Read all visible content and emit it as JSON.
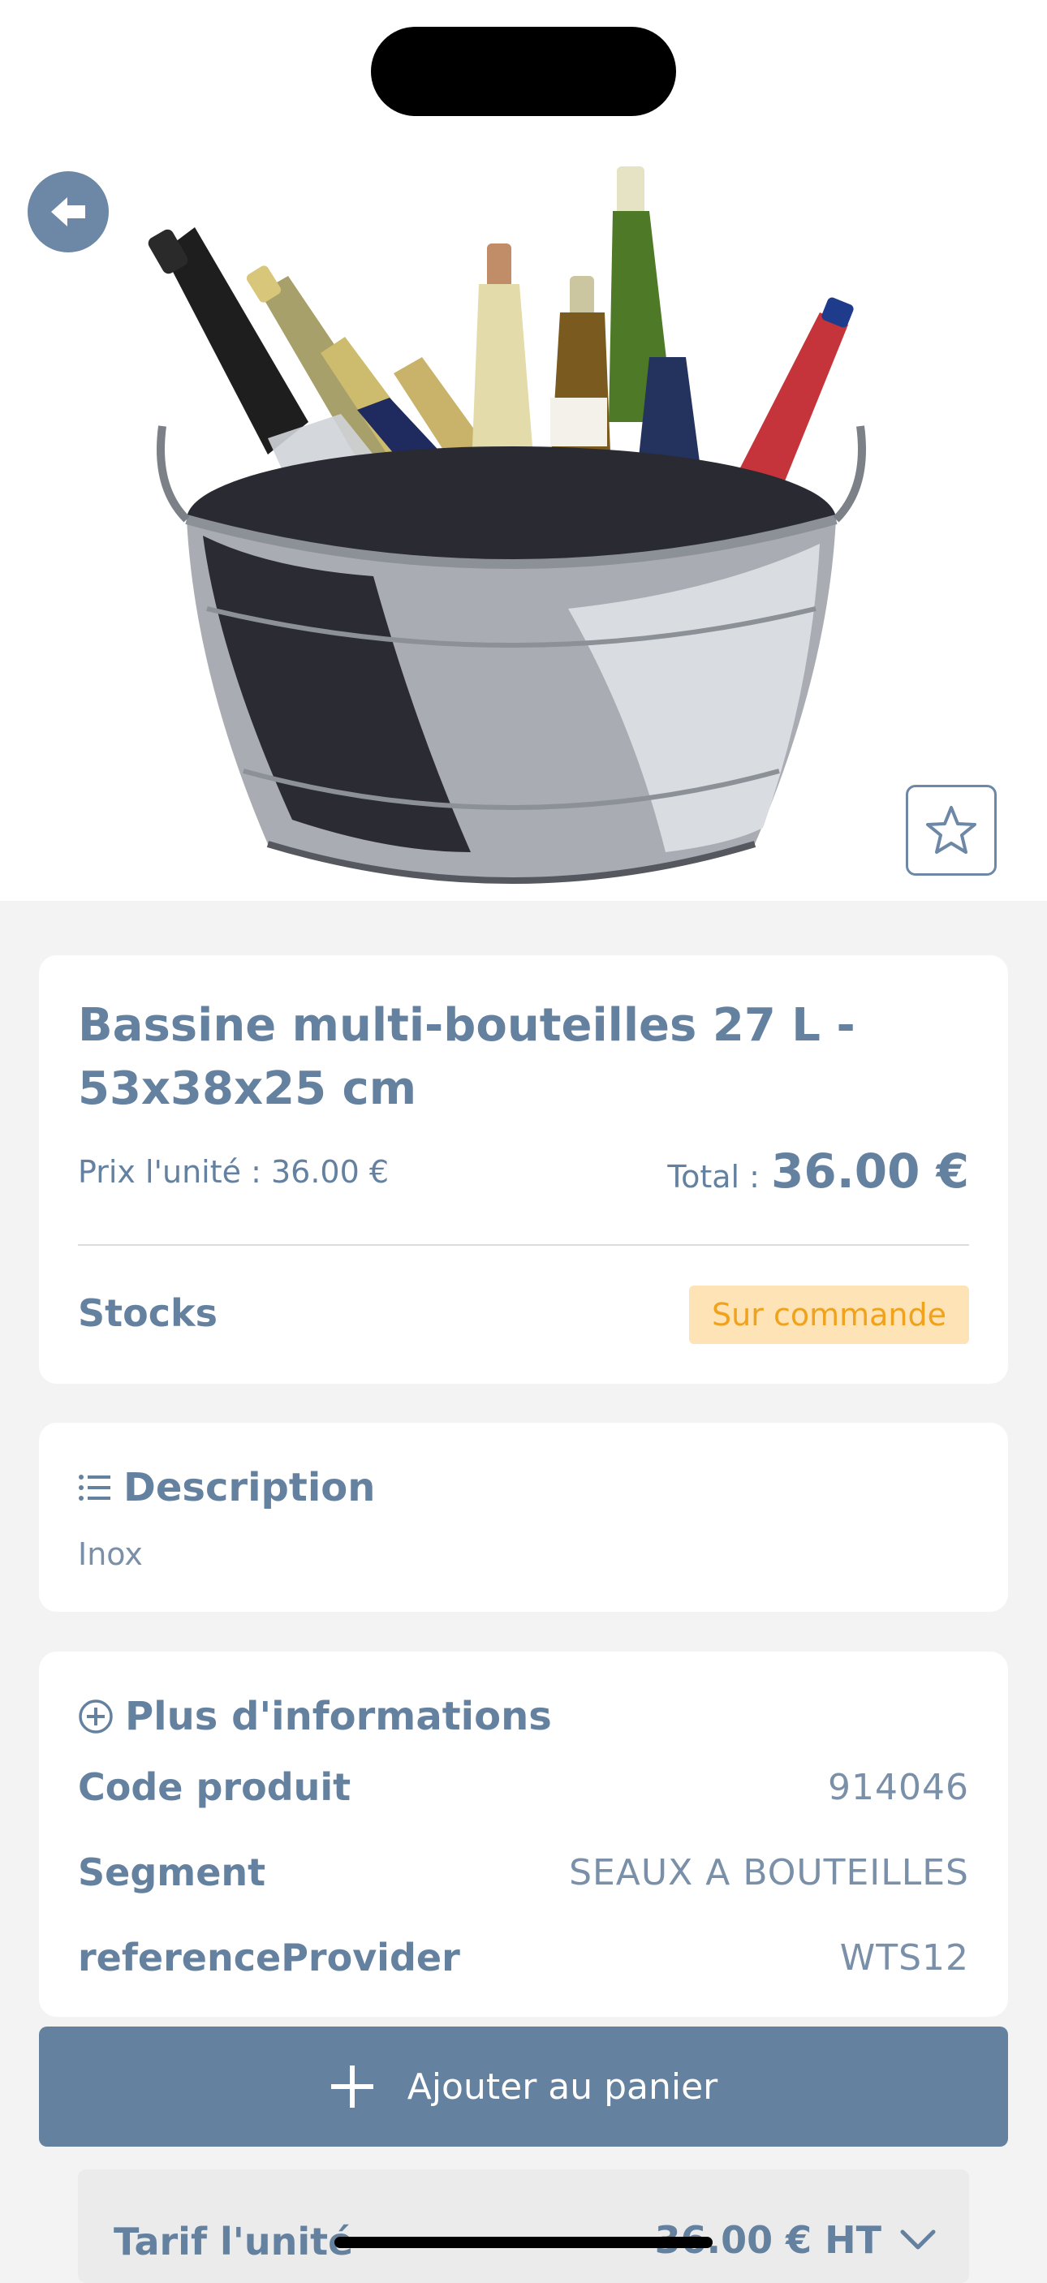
{
  "product": {
    "title": "Bassine multi-bouteilles 27 L - 53x38x25 cm",
    "unit_price_text": "Prix l'unité : 36.00 €",
    "total_label": "Total :",
    "total_value": "36.00 €",
    "stocks_label": "Stocks",
    "stock_status": "Sur commande"
  },
  "description": {
    "title": "Description",
    "text": "Inox"
  },
  "more_info": {
    "title": "Plus d'informations",
    "rows": [
      {
        "key": "Code produit",
        "value": "914046"
      },
      {
        "key": "Segment",
        "value": "SEAUX A BOUTEILLES"
      },
      {
        "key": "referenceProvider",
        "value": "WTS12"
      }
    ]
  },
  "actions": {
    "add_to_cart_label": "Ajouter au panier"
  },
  "tarif": {
    "label": "Tarif l'unité",
    "value": "36.00 € HT"
  },
  "icons": {
    "back": "arrow-left-icon",
    "favorite": "star-icon",
    "description": "list-icon",
    "more_info": "plus-circle-icon",
    "add": "plus-icon",
    "expand": "chevron-down-icon"
  },
  "colors": {
    "primary": "#6581a0",
    "badge_bg": "#fde3b5",
    "badge_text": "#f0a21c"
  }
}
